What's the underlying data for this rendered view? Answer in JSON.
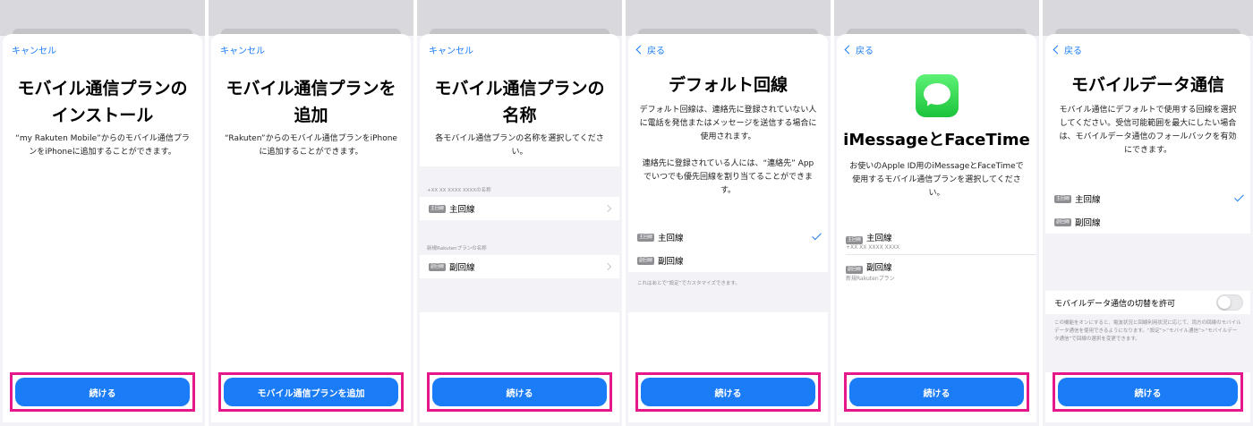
{
  "screens": [
    {
      "nav": "キャンセル",
      "title": [
        "モバイル通信プランの",
        "インストール"
      ],
      "description": "“my Rakuten Mobile”からのモバイル通信プランをiPhoneに追加することができます。",
      "button": "続ける"
    },
    {
      "nav": "キャンセル",
      "title": [
        "モバイル通信プランを",
        "追加"
      ],
      "description": "“Rakuten”からのモバイル通信プランをiPhoneに追加することができます。",
      "button": "モバイル通信プランを追加"
    },
    {
      "nav": "キャンセル",
      "title": [
        "モバイル通信プランの",
        "名称"
      ],
      "description": "各モバイル通信プランの名称を選択してください。",
      "section1_label": "+XX XX XXXX XXXXの名称",
      "row1_badge": "主回線",
      "row1_label": "主回線",
      "section2_label": "新規Rakutenプランの名称",
      "row2_badge": "副回線",
      "row2_label": "副回線",
      "button": "続ける"
    },
    {
      "nav": "戻る",
      "title": [
        "デフォルト回線"
      ],
      "description1": "デフォルト回線は、連絡先に登録されていない人に電話を発信またはメッセージを送信する場合に使用されます。",
      "description2": "連絡先に登録されている人には、“連絡先” Appでいつでも優先回線を割り当てることができます。",
      "row1_badge": "主回線",
      "row1_label": "主回線",
      "row2_badge": "副回線",
      "row2_label": "副回線",
      "note": "これはあとで“設定”でカスタマイズできます。",
      "button": "続ける"
    },
    {
      "nav": "戻る",
      "icon": "messages-app-icon",
      "title": [
        "iMessageとFaceTime"
      ],
      "description": "お使いのApple ID用のiMessageとFaceTimeで使用するモバイル通信プランを選択してください。",
      "row1_badge": "主回線",
      "row1_label": "主回線",
      "row1_sub": "+XX XX XXXX XXXX",
      "row2_badge": "副回線",
      "row2_label": "副回線",
      "row2_sub": "新規Rakutenプラン",
      "button": "続ける"
    },
    {
      "nav": "戻る",
      "title": [
        "モバイルデータ通信"
      ],
      "description": "モバイル通信にデフォルトで使用する回線を選択してください。受信可能範囲を最大にしたい場合は、モバイルデータ通信のフォールバックを有効にできます。",
      "row1_badge": "主回線",
      "row1_label": "主回線",
      "row2_badge": "副回線",
      "row2_label": "副回線",
      "toggle_label": "モバイルデータ通信の切替を許可",
      "toggle_state": "off",
      "note": "この機能をオンにすると、電波状況と回線利用状況に応じて、両方の回線のモバイルデータ通信を使用できるようになります。“設定”>“モバイル通信”>“モバイルデータ通信”で回線の選択を変更できます。",
      "button": "続ける"
    }
  ],
  "colors": {
    "accent": "#1a7cf7",
    "highlight": "#e6178b",
    "background": "#f2f2f7"
  }
}
